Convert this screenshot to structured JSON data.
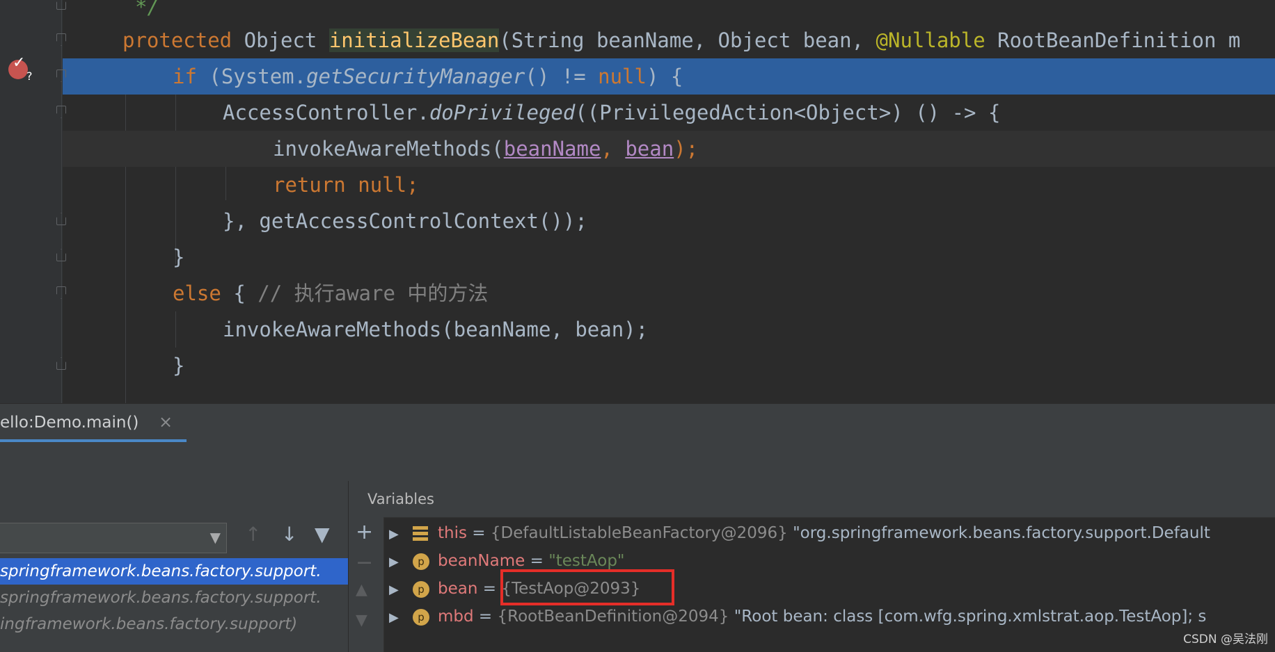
{
  "editor": {
    "lines": [
      {
        "text": "*/"
      },
      {
        "kw": "protected",
        "t1": "Object",
        "method": "initializeBean",
        "t2": "(String beanName, Object bean, ",
        "anno": "@Nullable",
        "t3": "RootBeanDefinition m"
      },
      {
        "kw": "if",
        "t1": "(System.",
        "call": "getSecurityManager",
        "t2": "() != ",
        "nul": "null",
        "t3": ") {"
      },
      {
        "t1": "AccessController.",
        "call": "doPrivileged",
        "t2": "((PrivilegedAction<Object>) () -> {"
      },
      {
        "t1": "invokeAwareMethods(",
        "p1": "beanName",
        "sep": ", ",
        "p2": "bean",
        "t2": ");"
      },
      {
        "kw": "return",
        "nul": "null;"
      },
      {
        "t1": "}, getAccessControlContext());"
      },
      {
        "t1": "}"
      },
      {
        "kw": "else",
        "t1": "{ ",
        "cmt": "// 执行aware 中的方法"
      },
      {
        "t1": "invokeAwareMethods(beanName, bean);"
      },
      {
        "t1": "}"
      }
    ]
  },
  "debug": {
    "run_tab": "ello:Demo.main()",
    "close_glyph": "×",
    "frames": [
      "springframework.beans.factory.support.",
      "springframework.beans.factory.support.",
      "ingframework.beans.factory.support)"
    ],
    "variables_title": "Variables",
    "variables": [
      {
        "name": "this",
        "eq": " = ",
        "ref": "{DefaultListableBeanFactory@2096}",
        "desc": " \"org.springframework.beans.factory.support.Default"
      },
      {
        "name": "beanName",
        "eq": " = ",
        "str": "\"testAop\""
      },
      {
        "name": "bean",
        "eq": " = ",
        "ref": "{TestAop@2093}"
      },
      {
        "name": "mbd",
        "eq": " = ",
        "ref": "{RootBeanDefinition@2094}",
        "desc": " \"Root bean: class [com.wfg.spring.xmlstrat.aop.TestAop]; s"
      }
    ],
    "badge_letter": "p"
  },
  "watermark": "CSDN @吴法刚",
  "colors": {
    "accent": "#2d5f9e",
    "keyword": "#cc7832",
    "highlight_box": "#e52e28"
  }
}
